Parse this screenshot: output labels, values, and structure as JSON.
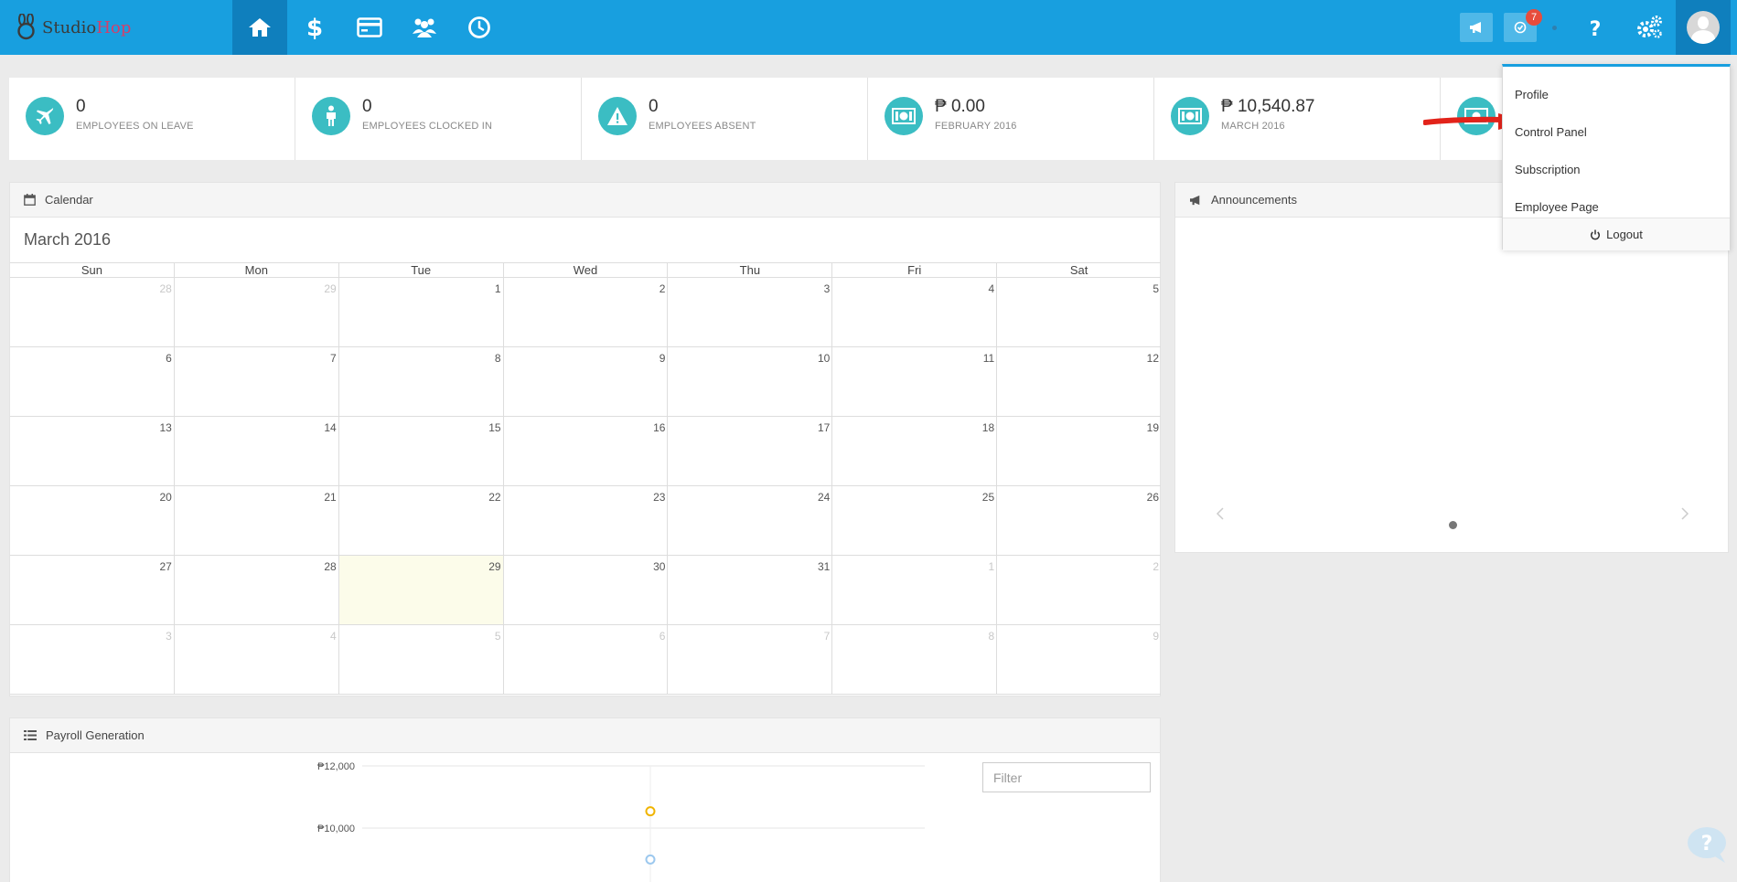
{
  "brand": {
    "name_part1": "Studio",
    "name_part2": "Hop"
  },
  "nav": {
    "items": [
      {
        "icon": "home-icon"
      },
      {
        "icon": "dollar-icon"
      },
      {
        "icon": "credit-card-icon"
      },
      {
        "icon": "users-icon"
      },
      {
        "icon": "clock-icon"
      }
    ],
    "notifications_badge": "7"
  },
  "stats": [
    {
      "value": "0",
      "label": "Employees on leave",
      "icon": "plane-icon"
    },
    {
      "value": "0",
      "label": "Employees clocked in",
      "icon": "person-icon"
    },
    {
      "value": "0",
      "label": "Employees absent",
      "icon": "warning-icon"
    },
    {
      "value": "₱ 0.00",
      "label": "February 2016",
      "icon": "money-icon"
    },
    {
      "value": "₱ 10,540.87",
      "label": "March 2016",
      "icon": "money-icon"
    }
  ],
  "calendar": {
    "panel_title": "Calendar",
    "month_title": "March 2016",
    "days_of_week": [
      "Sun",
      "Mon",
      "Tue",
      "Wed",
      "Thu",
      "Fri",
      "Sat"
    ],
    "weeks": [
      [
        {
          "d": "28",
          "m": true
        },
        {
          "d": "29",
          "m": true
        },
        {
          "d": "1"
        },
        {
          "d": "2"
        },
        {
          "d": "3"
        },
        {
          "d": "4"
        },
        {
          "d": "5"
        }
      ],
      [
        {
          "d": "6"
        },
        {
          "d": "7"
        },
        {
          "d": "8"
        },
        {
          "d": "9"
        },
        {
          "d": "10"
        },
        {
          "d": "11"
        },
        {
          "d": "12"
        }
      ],
      [
        {
          "d": "13"
        },
        {
          "d": "14"
        },
        {
          "d": "15"
        },
        {
          "d": "16"
        },
        {
          "d": "17"
        },
        {
          "d": "18"
        },
        {
          "d": "19"
        }
      ],
      [
        {
          "d": "20"
        },
        {
          "d": "21"
        },
        {
          "d": "22"
        },
        {
          "d": "23"
        },
        {
          "d": "24"
        },
        {
          "d": "25"
        },
        {
          "d": "26"
        }
      ],
      [
        {
          "d": "27"
        },
        {
          "d": "28"
        },
        {
          "d": "29",
          "today": true
        },
        {
          "d": "30"
        },
        {
          "d": "31"
        },
        {
          "d": "1",
          "m": true
        },
        {
          "d": "2",
          "m": true
        }
      ],
      [
        {
          "d": "3",
          "m": true
        },
        {
          "d": "4",
          "m": true
        },
        {
          "d": "5",
          "m": true
        },
        {
          "d": "6",
          "m": true
        },
        {
          "d": "7",
          "m": true
        },
        {
          "d": "8",
          "m": true
        },
        {
          "d": "9",
          "m": true
        }
      ]
    ]
  },
  "announcements": {
    "panel_title": "Announcements"
  },
  "payroll": {
    "panel_title": "Payroll Generation",
    "filter_placeholder": "Filter"
  },
  "chart_data": {
    "type": "line",
    "y_tick_labels": [
      "₱12,000",
      "₱10,000"
    ],
    "ylim": [
      8000,
      12000
    ],
    "grid": true,
    "series": [
      {
        "color": "#f0b400",
        "values": [
          10540.87
        ]
      },
      {
        "color": "#9cc8ee",
        "values": [
          8990
        ]
      }
    ]
  },
  "user_menu": {
    "items": [
      "Profile",
      "Control Panel",
      "Subscription",
      "Employee Page"
    ],
    "logout_label": "Logout"
  },
  "colors": {
    "primary": "#189fdf",
    "primary_dark": "#0f7fbd",
    "stat_icon": "#3bbdc3",
    "badge": "#e74c3c",
    "annotation_arrow": "#e2231a"
  }
}
